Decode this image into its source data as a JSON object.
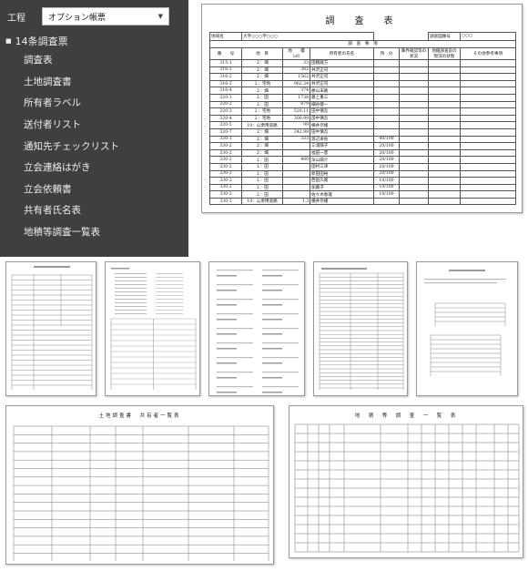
{
  "menu": {
    "label_kotei": "工程",
    "select_value": "オプション帳票",
    "section_label": "14条調査票",
    "items": [
      {
        "label": "調査表"
      },
      {
        "label": "土地調査書"
      },
      {
        "label": "所有者ラベル"
      },
      {
        "label": "送付者リスト"
      },
      {
        "label": "通知先チェックリスト"
      },
      {
        "label": "立会連絡はがき"
      },
      {
        "label": "立会依頼書"
      },
      {
        "label": "共有者氏名表"
      },
      {
        "label": "地積等調査一覧表"
      }
    ],
    "colors": {
      "background": "#3d3f40",
      "text": "#eeeeee"
    }
  },
  "survey": {
    "title": "調　査　表",
    "area_label": "地域名",
    "area_value": "大字○○○字○○○",
    "number_label": "調査図番号",
    "number_value": "○○○",
    "section_header": "調　査　事　項",
    "columns": [
      "番　　号",
      "地　目",
      "地　　積\n（㎡）",
      "所有者の氏名",
      "持　分",
      "筆界確認等の状況",
      "地籍調査前の現況の状態",
      "その他参考事項"
    ],
    "rows": [
      [
        "315-1",
        "２：畑",
        "33",
        "田積蔵方",
        ""
      ],
      [
        "316-1",
        "２：畑",
        "382",
        "井沢正司",
        ""
      ],
      [
        "316-2",
        "２：畑",
        "1562",
        "井沢正司",
        ""
      ],
      [
        "316-3",
        "１：宅地",
        "962.34",
        "井沢正司",
        ""
      ],
      [
        "316-4",
        "２：畑",
        "374",
        "勝山末路",
        ""
      ],
      [
        "320-1",
        "１：田",
        "1738",
        "藤上重三",
        ""
      ],
      [
        "320-2",
        "１：田",
        "879",
        "細谷健一",
        ""
      ],
      [
        "320-3",
        "１：宅地",
        "520.11",
        "田中慎吾",
        ""
      ],
      [
        "320-4",
        "１：宅地",
        "300.99",
        "田中慎吾",
        ""
      ],
      [
        "320-5",
        "19：公衆用道路",
        "99",
        "横井奈緒",
        ""
      ],
      [
        "320-7",
        "２：畑",
        "342.98",
        "田中慎吾",
        ""
      ],
      [
        "330-1",
        "２：畑",
        "333",
        "渡辺本佐",
        "40/100"
      ],
      [
        "330-2",
        "２：畑",
        "",
        "三浦陽子",
        "20/100"
      ],
      [
        "330-2",
        "２：畑",
        "",
        "福田一彦",
        "20/100"
      ],
      [
        "330-2",
        "１：田",
        "400",
        "深山陽介",
        "20/100"
      ],
      [
        "330-2",
        "１：田",
        "",
        "田村三津",
        "20/100"
      ],
      [
        "330-2",
        "１：田",
        "",
        "新田田裕",
        "20/100"
      ],
      [
        "330-2",
        "１：田",
        "",
        "西田久蔵",
        "10/100"
      ],
      [
        "330-2",
        "１：田",
        "",
        "加藤子",
        "10/100"
      ],
      [
        "330-2",
        "１：田",
        "",
        "佐々木春雄",
        "10/100"
      ],
      [
        "330-3",
        "19：公衆用道路",
        "1.3",
        "横井奈緒",
        ""
      ]
    ]
  },
  "bottom_left": {
    "title": "土地調査書　共有者一覧表",
    "header_left": "共有者氏名",
    "header_right": "共　有　者　一　覧"
  },
  "bottom_right": {
    "title": "地　積　等　調　査　一　覧　表"
  }
}
